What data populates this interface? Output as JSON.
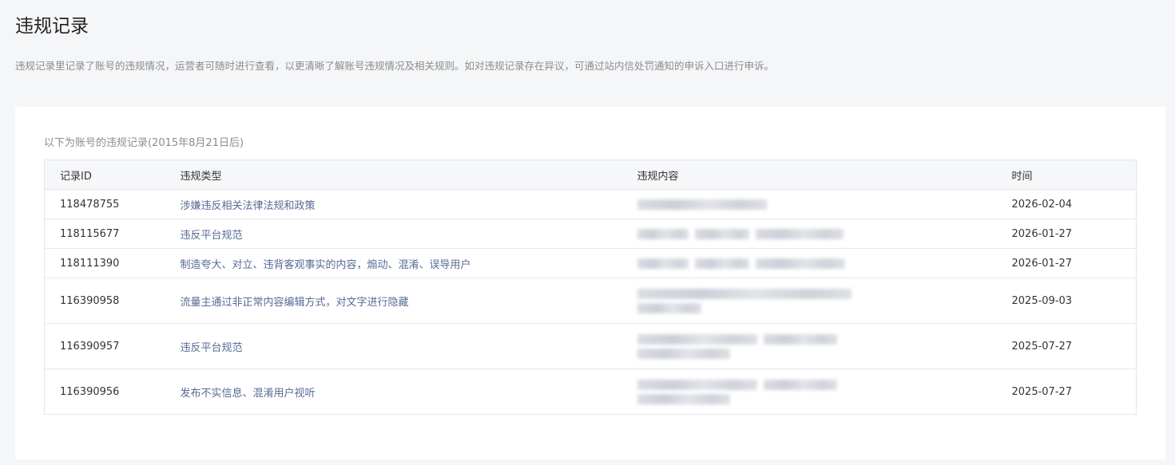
{
  "page": {
    "title": "违规记录",
    "description": "违规记录里记录了账号的违规情况，运营者可随时进行查看，以更清晰了解账号违规情况及相关规则。如对违规记录存在异议，可通过站内信处罚通知的申诉入口进行申诉。"
  },
  "records": {
    "caption": "以下为账号的违规记录(2015年8月21日后)",
    "columns": {
      "id": "记录ID",
      "type": "违规类型",
      "content": "违规内容",
      "time": "时间"
    },
    "rows": [
      {
        "id": "118478755",
        "type": "涉嫌违反相关法律法规和政策",
        "time": "2026-02-04"
      },
      {
        "id": "118115677",
        "type": "违反平台规范",
        "time": "2026-01-27"
      },
      {
        "id": "118111390",
        "type": "制造夸大、对立、违背客观事实的内容，煽动、混淆、误导用户",
        "time": "2026-01-27"
      },
      {
        "id": "116390958",
        "type": "流量主通过非正常内容编辑方式，对文字进行隐藏",
        "time": "2025-09-03"
      },
      {
        "id": "116390957",
        "type": "违反平台规范",
        "time": "2025-07-27"
      },
      {
        "id": "116390956",
        "type": "发布不实信息、混淆用户视听",
        "time": "2025-07-27"
      }
    ]
  }
}
